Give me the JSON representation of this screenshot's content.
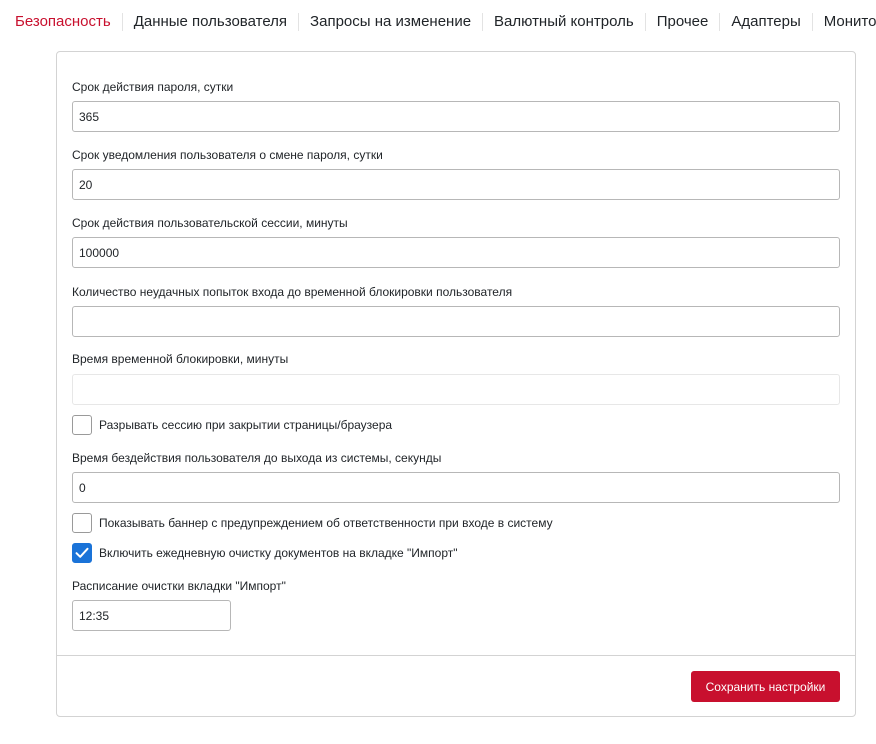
{
  "tabs": [
    {
      "label": "Безопасность",
      "active": true
    },
    {
      "label": "Данные пользователя",
      "active": false
    },
    {
      "label": "Запросы на изменение",
      "active": false
    },
    {
      "label": "Валютный контроль",
      "active": false
    },
    {
      "label": "Прочее",
      "active": false
    },
    {
      "label": "Адаптеры",
      "active": false
    },
    {
      "label": "Мониторинг",
      "active": false
    }
  ],
  "form": {
    "password_expiry": {
      "label": "Срок действия пароля, сутки",
      "value": "365"
    },
    "password_notice": {
      "label": "Срок уведомления пользователя о смене пароля, сутки",
      "value": "20"
    },
    "session_expiry": {
      "label": "Срок действия пользовательской сессии, минуты",
      "value": "100000"
    },
    "failed_attempts": {
      "label": "Количество неудачных попыток входа до временной блокировки пользователя",
      "value": ""
    },
    "lock_time": {
      "label": "Время временной блокировки, минуты",
      "value": ""
    },
    "close_session_checkbox": {
      "label": "Разрывать сессию при закрытии страницы/браузера",
      "checked": false
    },
    "idle_timeout": {
      "label": "Время бездействия пользователя до выхода из системы, секунды",
      "value": "0"
    },
    "banner_checkbox": {
      "label": "Показывать баннер с предупреждением об ответственности при входе в систему",
      "checked": false
    },
    "daily_cleanup_checkbox": {
      "label": "Включить ежедневную очистку документов на вкладке \"Импорт\"",
      "checked": true
    },
    "cleanup_schedule": {
      "label": "Расписание очистки вкладки \"Импорт\"",
      "value": "12:35"
    }
  },
  "actions": {
    "save_label": "Сохранить настройки"
  },
  "colors": {
    "accent": "#c8102e",
    "checkbox_checked": "#1a73d8"
  }
}
